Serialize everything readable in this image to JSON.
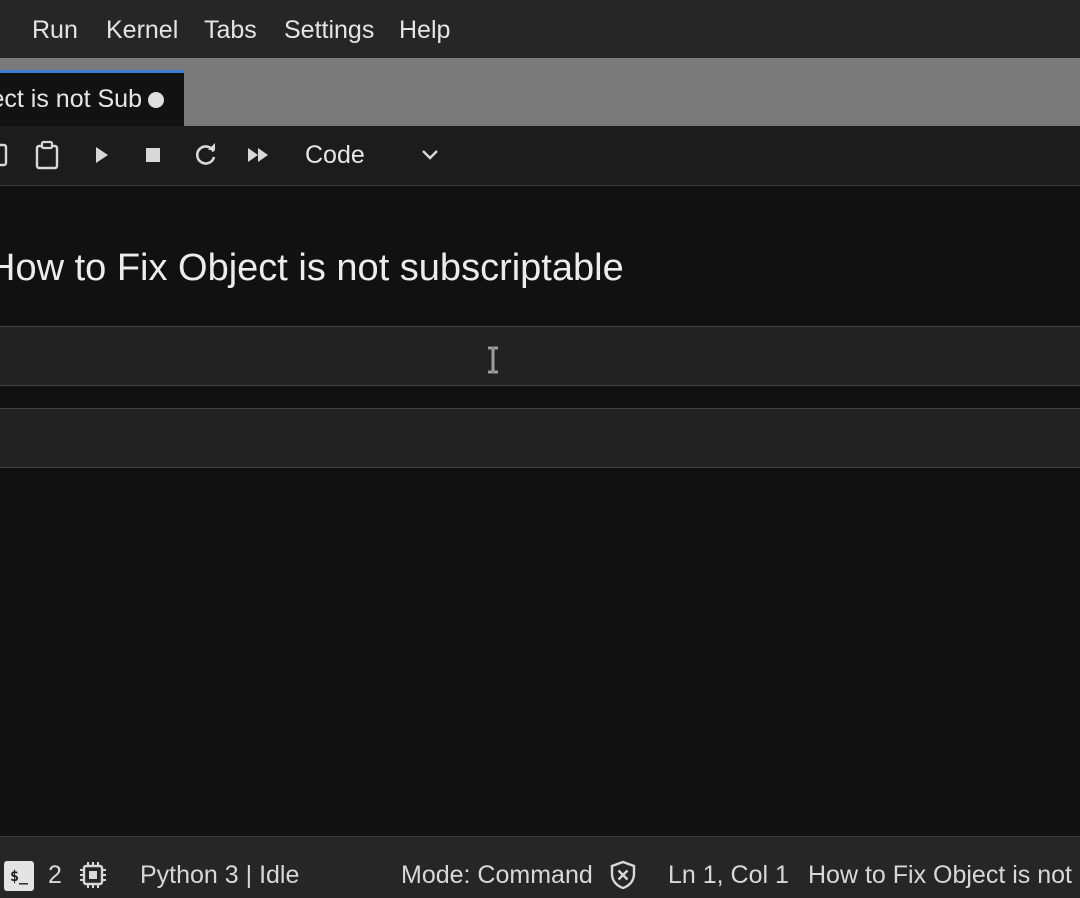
{
  "menubar": {
    "items": [
      {
        "label": "Run"
      },
      {
        "label": "Kernel"
      },
      {
        "label": "Tabs"
      },
      {
        "label": "Settings"
      },
      {
        "label": "Help"
      }
    ]
  },
  "tabs": {
    "active": {
      "label": "Object is not Sub",
      "unsaved": true
    }
  },
  "toolbar": {
    "icons": [
      "copy-icon",
      "paste-icon",
      "run-icon",
      "stop-icon",
      "restart-icon",
      "fast-forward-icon"
    ],
    "cell_type": {
      "selected": "Code"
    }
  },
  "notebook": {
    "markdown_heading": "How to Fix Object is not subscriptable",
    "code_cells": [
      {
        "content": ""
      },
      {
        "content": ""
      }
    ]
  },
  "statusbar": {
    "terminal_badge": "$_",
    "terminal_count": "2",
    "kernel_status": "Python 3 | Idle",
    "mode": "Mode: Command",
    "cursor_position": "Ln 1, Col 1",
    "notebook_name": "How to Fix Object is not Subscriptable.ipynb"
  },
  "colors": {
    "accent": "#3d7fd0",
    "background": "#111111",
    "bar": "#262626",
    "tabbar": "#7a7a7a"
  }
}
